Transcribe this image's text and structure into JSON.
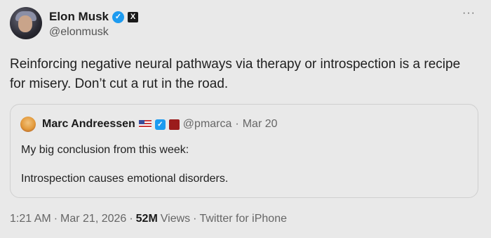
{
  "author": {
    "name": "Elon Musk",
    "handle": "@elonmusk",
    "verified_icon": "verified-badge",
    "affiliation_icon": "x-logo"
  },
  "tweet": {
    "text": "Reinforcing negative neural pathways via therapy or introspection is a recipe for misery. Don’t cut a rut in the road."
  },
  "quoted": {
    "name": "Marc Andreessen",
    "handle": "@pmarca",
    "separator": "·",
    "date": "Mar 20",
    "line1": "My big conclusion from this week:",
    "line2": "Introspection causes emotional disorders."
  },
  "meta": {
    "time": "1:21 AM",
    "dot1": "·",
    "date": "Mar 21, 2026",
    "dot2": "·",
    "views_count": "52M",
    "views_label": "Views",
    "dot3": "·",
    "client": "Twitter for iPhone"
  },
  "colors": {
    "background": "#e9e9e9",
    "verified_blue": "#1d9bf0",
    "muted_text": "#666666"
  }
}
